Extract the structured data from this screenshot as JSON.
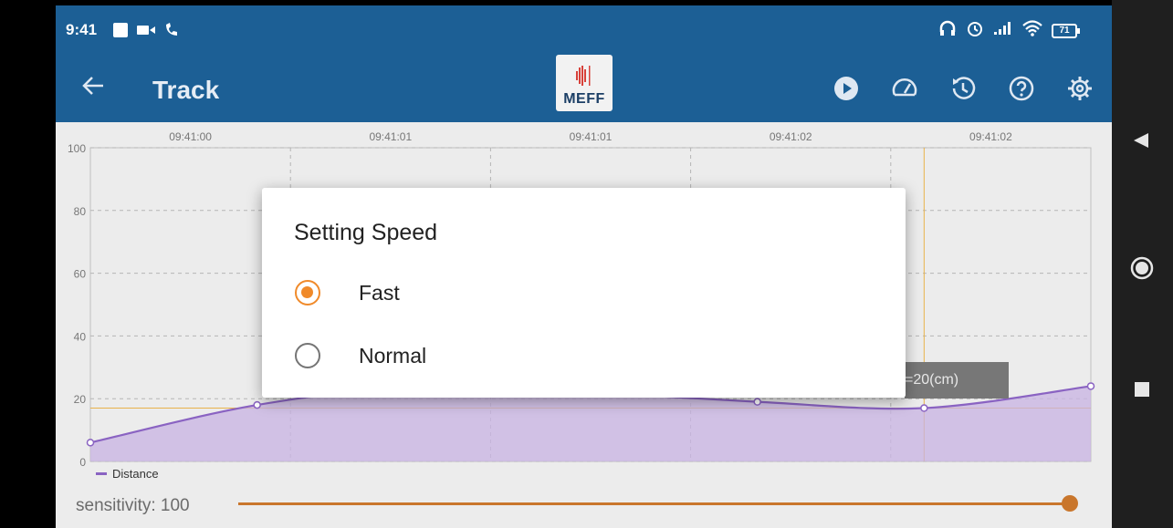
{
  "status_bar": {
    "time": "9:41",
    "left_icons": [
      "notification-square-icon",
      "video-camera-icon",
      "wifi-call-icon"
    ],
    "right_icons": [
      "headphones-icon",
      "alarm-icon",
      "signal-icon",
      "wifi-icon"
    ],
    "battery": "71"
  },
  "app_bar": {
    "title": "Track",
    "logo_text": "MEFF",
    "actions": [
      "play-icon",
      "speedometer-icon",
      "history-icon",
      "help-icon",
      "settings-icon"
    ]
  },
  "chart_data": {
    "type": "line",
    "x_tick_labels": [
      "09:41:00",
      "09:41:01",
      "09:41:01",
      "09:41:02",
      "09:41:02"
    ],
    "y_ticks": [
      0,
      20,
      40,
      60,
      80,
      100
    ],
    "ylim": [
      0,
      100
    ],
    "series": [
      {
        "name": "Distance",
        "values": [
          6,
          18,
          24,
          22,
          19,
          17,
          24
        ]
      }
    ],
    "fill": true,
    "grid": true,
    "colors": {
      "line": "#8a63c2",
      "fill": "#c8b3e3",
      "highlight": "#e8b24a"
    },
    "legend": "bottom-left"
  },
  "tooltip": {
    "text": "=20(cm)"
  },
  "sensitivity": {
    "label": "sensitivity: 100",
    "value": 100
  },
  "dialog": {
    "title": "Setting Speed",
    "options": [
      {
        "label": "Fast",
        "selected": true
      },
      {
        "label": "Normal",
        "selected": false
      }
    ]
  },
  "colors": {
    "app_bar": "#1c5f95",
    "accent": "#f08a2a",
    "slider": "#c9762c"
  }
}
